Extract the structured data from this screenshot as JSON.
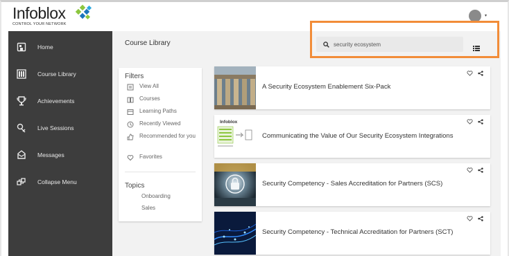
{
  "brand": {
    "name": "Infoblox",
    "tagline": "CONTROL YOUR NETWORK"
  },
  "sidebar": {
    "items": [
      {
        "label": "Home",
        "icon": "home-icon"
      },
      {
        "label": "Course Library",
        "icon": "library-icon"
      },
      {
        "label": "Achievements",
        "icon": "trophy-icon"
      },
      {
        "label": "Live Sessions",
        "icon": "live-sessions-icon"
      },
      {
        "label": "Messages",
        "icon": "messages-icon"
      },
      {
        "label": "Collapse Menu",
        "icon": "collapse-icon"
      }
    ]
  },
  "main": {
    "title": "Course Library",
    "search": {
      "value": "security ecosystem",
      "placeholder": "Search"
    }
  },
  "filters": {
    "heading": "Filters",
    "items": [
      {
        "label": "View All",
        "icon": "view-all-icon"
      },
      {
        "label": "Courses",
        "icon": "book-icon"
      },
      {
        "label": "Learning Paths",
        "icon": "learning-path-icon"
      },
      {
        "label": "Recently Viewed",
        "icon": "clock-icon"
      },
      {
        "label": "Recommended for you",
        "icon": "thumbs-up-icon"
      },
      {
        "label": "Favorites",
        "icon": "heart-icon"
      }
    ],
    "topics_heading": "Topics",
    "topics": [
      "Onboarding",
      "Sales"
    ]
  },
  "courses": [
    {
      "title": "A Security Ecosystem Enablement Six-Pack",
      "thumb": "columns"
    },
    {
      "title": "Communicating the Value of Our Security Ecosystem Integrations",
      "thumb": "diagram",
      "thumb_label": "Infoblox"
    },
    {
      "title": "Security Competency - Sales Accreditation for Partners (SCS)",
      "thumb": "lock"
    },
    {
      "title": "Security Competency - Technical Accreditation for Partners (SCT)",
      "thumb": "network"
    }
  ],
  "colors": {
    "sidebar": "#3d3d3d",
    "main_bg": "#f2f2f2",
    "highlight": "#f28c38",
    "logo_green": "#8cc63f",
    "logo_blue": "#1b75bb"
  }
}
